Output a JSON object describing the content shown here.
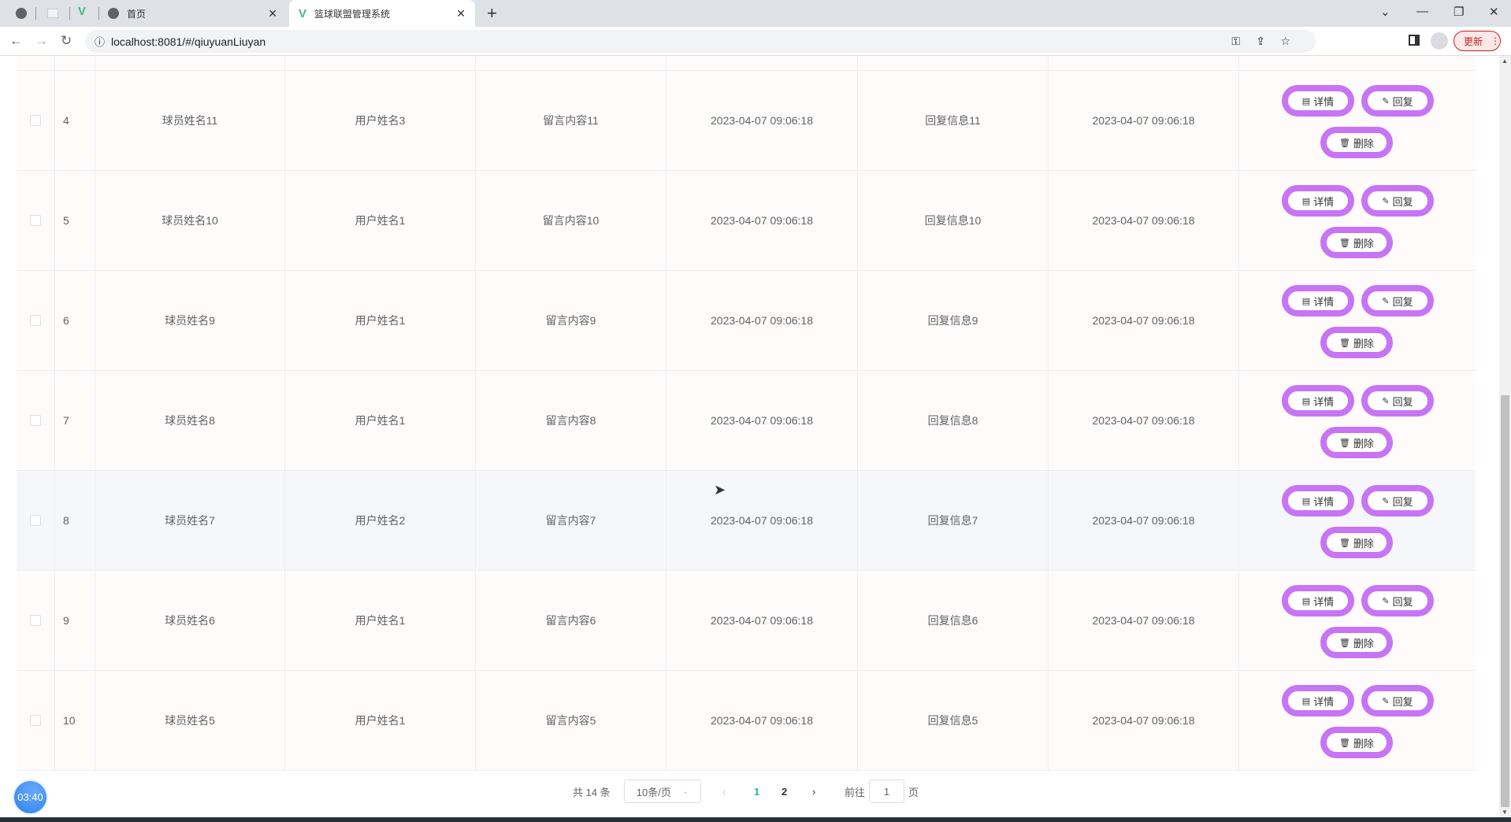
{
  "browser": {
    "tabs": [
      {
        "label": "首页"
      },
      {
        "label": "篮球联盟管理系统"
      }
    ],
    "url": "localhost:8081/#/qiuyuanLiuyan",
    "update_label": "更新"
  },
  "table": {
    "rows": [
      {
        "index": "4",
        "player": "球员姓名11",
        "user": "用户姓名3",
        "content": "留言内容11",
        "time": "2023-04-07 09:06:18",
        "reply": "回复信息11",
        "reply_time": "2023-04-07 09:06:18"
      },
      {
        "index": "5",
        "player": "球员姓名10",
        "user": "用户姓名1",
        "content": "留言内容10",
        "time": "2023-04-07 09:06:18",
        "reply": "回复信息10",
        "reply_time": "2023-04-07 09:06:18"
      },
      {
        "index": "6",
        "player": "球员姓名9",
        "user": "用户姓名1",
        "content": "留言内容9",
        "time": "2023-04-07 09:06:18",
        "reply": "回复信息9",
        "reply_time": "2023-04-07 09:06:18"
      },
      {
        "index": "7",
        "player": "球员姓名8",
        "user": "用户姓名1",
        "content": "留言内容8",
        "time": "2023-04-07 09:06:18",
        "reply": "回复信息8",
        "reply_time": "2023-04-07 09:06:18"
      },
      {
        "index": "8",
        "player": "球员姓名7",
        "user": "用户姓名2",
        "content": "留言内容7",
        "time": "2023-04-07 09:06:18",
        "reply": "回复信息7",
        "reply_time": "2023-04-07 09:06:18"
      },
      {
        "index": "9",
        "player": "球员姓名6",
        "user": "用户姓名1",
        "content": "留言内容6",
        "time": "2023-04-07 09:06:18",
        "reply": "回复信息6",
        "reply_time": "2023-04-07 09:06:18"
      },
      {
        "index": "10",
        "player": "球员姓名5",
        "user": "用户姓名1",
        "content": "留言内容5",
        "time": "2023-04-07 09:06:18",
        "reply": "回复信息5",
        "reply_time": "2023-04-07 09:06:18"
      }
    ],
    "actions": {
      "detail": "详情",
      "reply": "回复",
      "delete": "删除"
    },
    "button_color": "#c774f5"
  },
  "pagination": {
    "total": "共 14 条",
    "page_size": "10条/页",
    "pages": [
      "1",
      "2"
    ],
    "current": "1",
    "goto_label": "前往",
    "goto_value": "1",
    "page_suffix": "页",
    "active_color": "#1abc9c"
  },
  "timer": "03:40"
}
